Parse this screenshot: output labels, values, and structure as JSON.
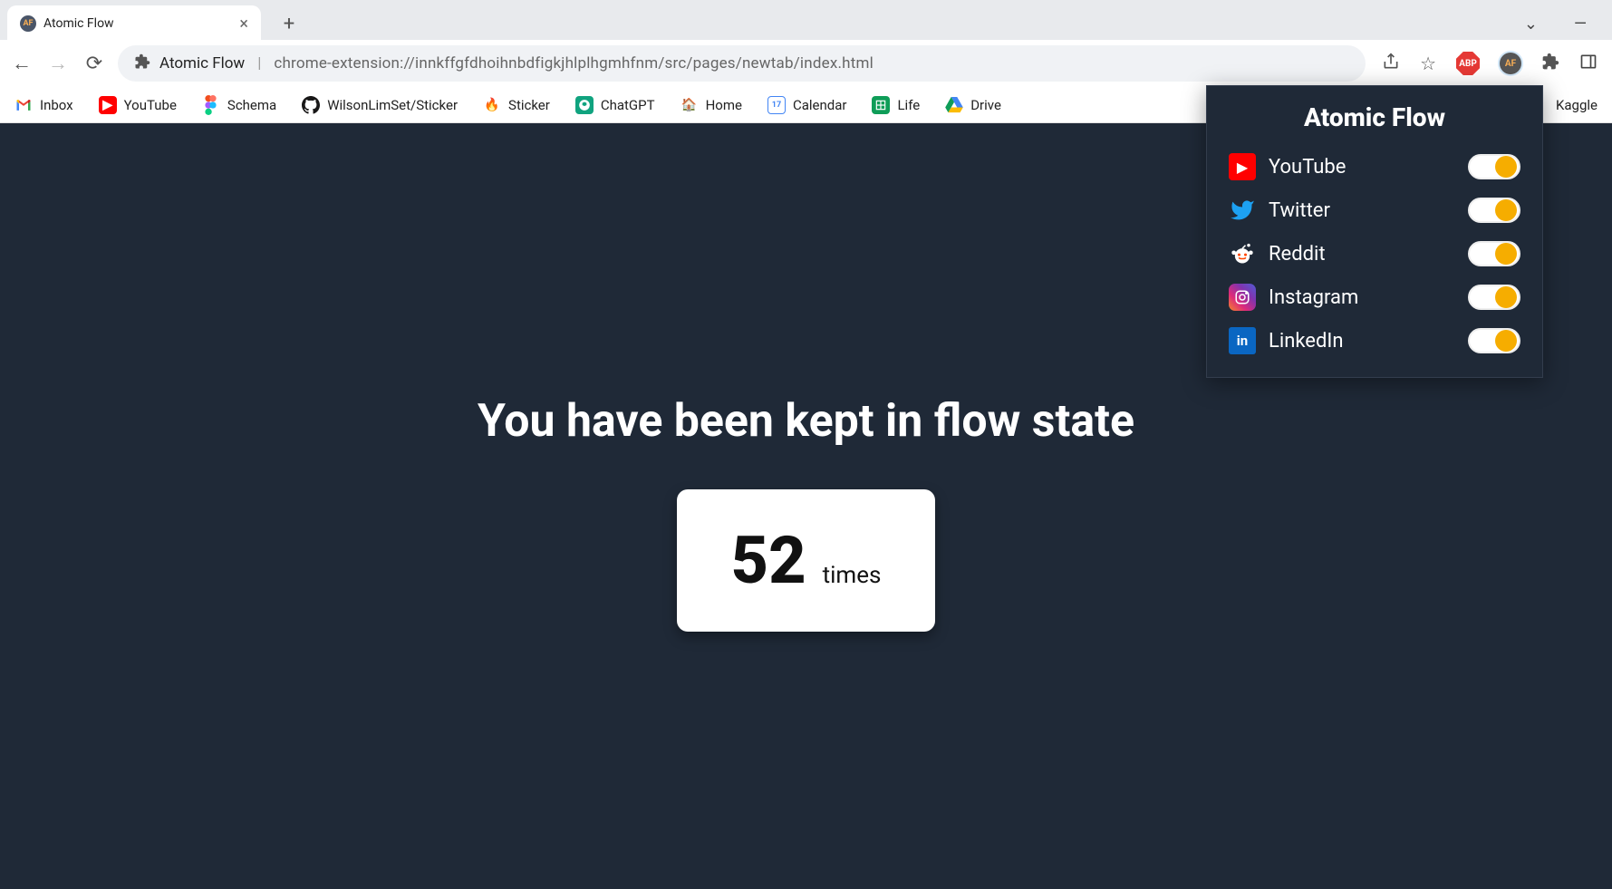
{
  "tab": {
    "title": "Atomic Flow",
    "favicon_text": "AF"
  },
  "omnibox": {
    "extension_name": "Atomic Flow",
    "url": "chrome-extension://innkffgfdhoihnbdfigkjhlplhgmhfnm/src/pages/newtab/index.html"
  },
  "toolbar_icons": {
    "abp": "ABP",
    "af": "AF"
  },
  "bookmarks": [
    {
      "label": "Inbox"
    },
    {
      "label": "YouTube"
    },
    {
      "label": "Schema"
    },
    {
      "label": "WilsonLimSet/Sticker"
    },
    {
      "label": "Sticker"
    },
    {
      "label": "ChatGPT"
    },
    {
      "label": "Home"
    },
    {
      "label": "Calendar"
    },
    {
      "label": "Life"
    },
    {
      "label": "Drive"
    },
    {
      "label": "Kaggle"
    }
  ],
  "page": {
    "heading": "You have been kept in flow state",
    "count": "52",
    "count_suffix": "times"
  },
  "popup": {
    "title": "Atomic Flow",
    "sites": [
      {
        "label": "YouTube",
        "on": true
      },
      {
        "label": "Twitter",
        "on": true
      },
      {
        "label": "Reddit",
        "on": true
      },
      {
        "label": "Instagram",
        "on": true
      },
      {
        "label": "LinkedIn",
        "on": true
      }
    ]
  }
}
